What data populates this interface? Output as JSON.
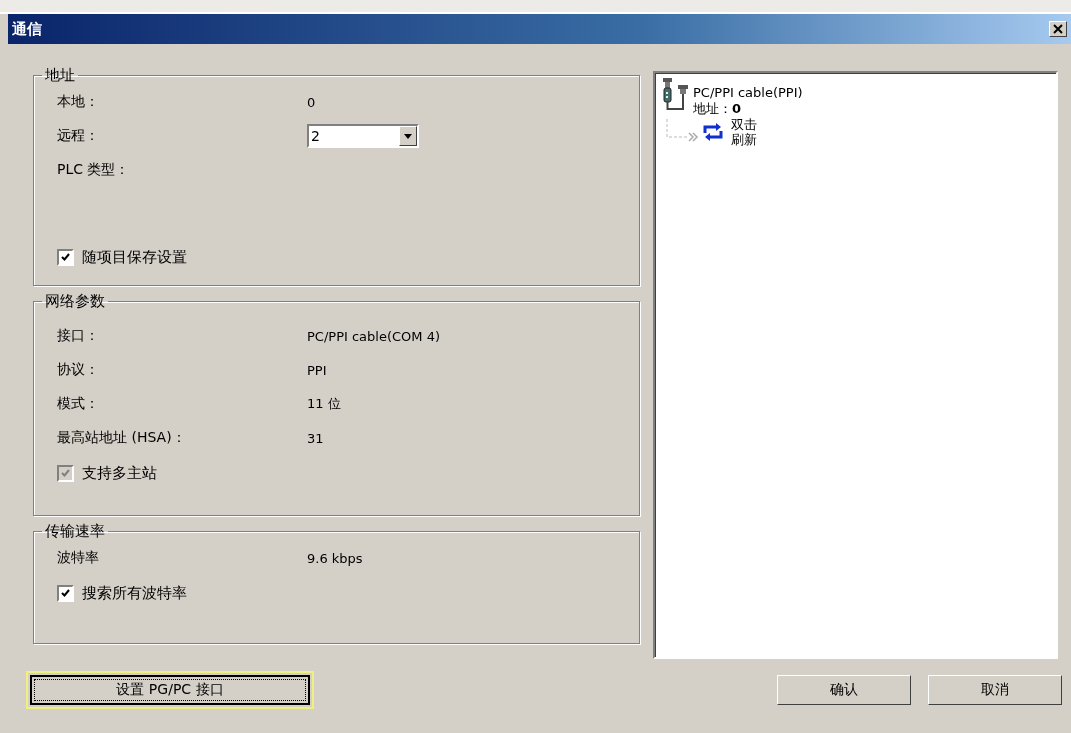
{
  "window": {
    "title": "通信"
  },
  "address": {
    "title": "地址",
    "rows": [
      {
        "kind": "value",
        "label": "本地：",
        "value": "0"
      },
      {
        "kind": "dropdown",
        "label": "远程：",
        "value": "2"
      },
      {
        "kind": "value",
        "label": "PLC 类型："
      }
    ],
    "checkbox": {
      "label": "随项目保存设置",
      "checked": true,
      "disabled": false
    }
  },
  "network": {
    "title": "网络参数",
    "rows": [
      {
        "kind": "value",
        "label": "接口：",
        "value": "PC/PPI cable(COM 4)"
      },
      {
        "kind": "value",
        "label": "协议：",
        "value": "PPI"
      },
      {
        "kind": "value",
        "label": "模式：",
        "value": "11 位"
      },
      {
        "kind": "value",
        "label": "最高站地址 (HSA)：",
        "value": "31"
      }
    ],
    "checkbox": {
      "label": "支持多主站",
      "checked": true,
      "disabled": true
    }
  },
  "baud": {
    "title": "传输速率",
    "rows": [
      {
        "kind": "value",
        "label": "波特率",
        "value": "9.6 kbps"
      }
    ],
    "checkbox": {
      "label": "搜索所有波特率",
      "checked": true,
      "disabled": false
    }
  },
  "tree": {
    "cable": {
      "name": "PC/PPI cable(PPI)",
      "address_label": "地址：",
      "address": "0"
    },
    "refresh": [
      "双击",
      "刷新"
    ]
  },
  "buttons": [
    {
      "label": "设置 PG/PC 接口",
      "focused": true
    },
    {
      "label": "确认",
      "focused": false
    },
    {
      "label": "取消",
      "focused": false
    }
  ]
}
